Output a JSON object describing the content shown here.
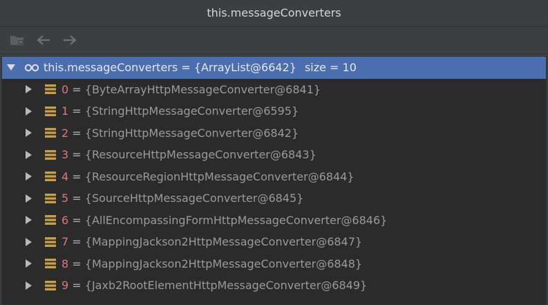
{
  "window": {
    "title": "this.messageConverters"
  },
  "toolbar": {
    "icons": [
      "folder-tree-icon",
      "back-arrow-icon",
      "forward-arrow-icon"
    ]
  },
  "tree": {
    "root": {
      "icon": "watch-glasses-icon",
      "text": "this.messageConverters = {ArrayList@6642}",
      "size": "size = 10"
    },
    "items": [
      {
        "index": "0",
        "sep": " = ",
        "value": "{ByteArrayHttpMessageConverter@6841}"
      },
      {
        "index": "1",
        "sep": " = ",
        "value": "{StringHttpMessageConverter@6595}"
      },
      {
        "index": "2",
        "sep": " = ",
        "value": "{StringHttpMessageConverter@6842}"
      },
      {
        "index": "3",
        "sep": " = ",
        "value": "{ResourceHttpMessageConverter@6843}"
      },
      {
        "index": "4",
        "sep": " = ",
        "value": "{ResourceRegionHttpMessageConverter@6844}"
      },
      {
        "index": "5",
        "sep": " = ",
        "value": "{SourceHttpMessageConverter@6845}"
      },
      {
        "index": "6",
        "sep": " = ",
        "value": "{AllEncompassingFormHttpMessageConverter@6846}"
      },
      {
        "index": "7",
        "sep": " = ",
        "value": "{MappingJackson2HttpMessageConverter@6847}"
      },
      {
        "index": "8",
        "sep": " = ",
        "value": "{MappingJackson2HttpMessageConverter@6848}"
      },
      {
        "index": "9",
        "sep": " = ",
        "value": "{Jaxb2RootElementHttpMessageConverter@6849}"
      }
    ]
  },
  "colors": {
    "background": "#3c3f41",
    "tree_background": "#2b2b2b",
    "selection": "#4b6eaf",
    "index_color": "#d97a7a",
    "field_icon": "#c9a04a"
  }
}
